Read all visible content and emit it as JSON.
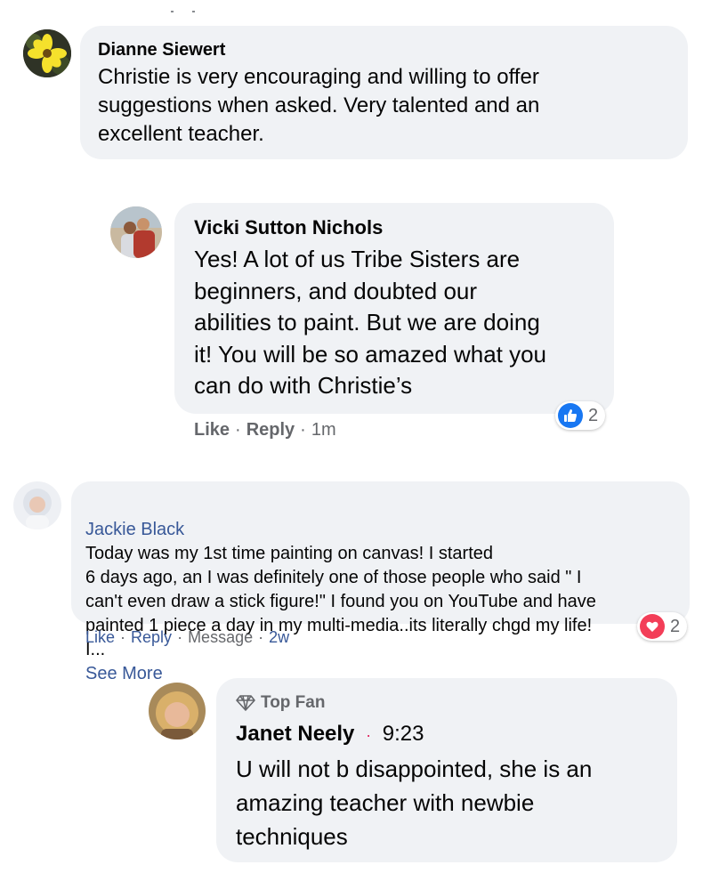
{
  "comments": [
    {
      "author": "Dianne Siewert",
      "text": "Christie is very encouraging and willing to offer\nsuggestions when asked. Very talented and an\nexcellent teacher."
    },
    {
      "author": "Vicki Sutton Nichols",
      "text": "Yes! A lot of us Tribe Sisters are\nbeginners, and doubted our\nabilities to paint. But we are doing\nit! You will be so amazed what you\ncan do with Christie’s",
      "actions": {
        "like": "Like",
        "reply": "Reply",
        "time": "1m"
      },
      "reaction": {
        "type": "like",
        "color": "#1877f2",
        "count": "2"
      }
    },
    {
      "author": "Jackie Black",
      "text": "Today was my 1st time painting on canvas! I started\n6 days ago, an I was definitely one of those people who said \" I\ncan't even draw a stick figure!\" I found you on YouTube and have\npainted 1 piece a day in my multi-media..its literally chgd my life!\nI...",
      "see_more": "See More",
      "actions": {
        "like": "Like",
        "reply": "Reply",
        "message": "Message",
        "time": "2w"
      },
      "reaction": {
        "type": "love",
        "color": "#f33e58",
        "count": "2"
      }
    },
    {
      "badge": "Top Fan",
      "author": "Janet Neely",
      "time": "9:23",
      "text": "U will not b disappointed, she is an\namazing teacher with newbie\ntechniques"
    }
  ]
}
